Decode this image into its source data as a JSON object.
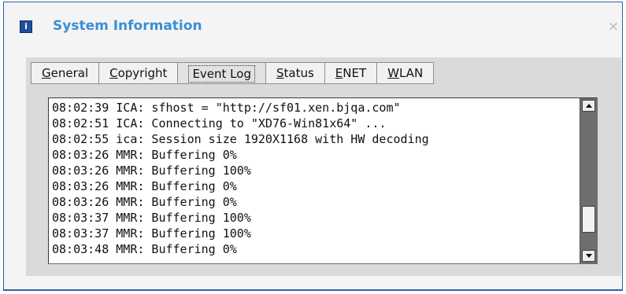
{
  "window": {
    "title": "System Information",
    "close_glyph": "×",
    "icon": "info-icon",
    "icon_glyph": "i"
  },
  "tabs": [
    {
      "label": "General",
      "mnemonic": "G",
      "active": false
    },
    {
      "label": "Copyright",
      "mnemonic": "C",
      "active": false
    },
    {
      "label": "Event Log",
      "mnemonic": "",
      "active": true
    },
    {
      "label": "Status",
      "mnemonic": "S",
      "active": false
    },
    {
      "label": "ENET",
      "mnemonic": "E",
      "active": false
    },
    {
      "label": "WLAN",
      "mnemonic": "W",
      "active": false
    }
  ],
  "event_log": {
    "lines": [
      "08:02:39 ICA: sfhost = \"http://sf01.xen.bjqa.com\"",
      "08:02:51 ICA: Connecting to \"XD76-Win81x64\" ...",
      "08:02:55 ica: Session size 1920X1168 with HW decoding",
      "08:03:26 MMR: Buffering 0%",
      "08:03:26 MMR: Buffering 100%",
      "08:03:26 MMR: Buffering 0%",
      "08:03:26 MMR: Buffering 0%",
      "08:03:37 MMR: Buffering 100%",
      "08:03:37 MMR: Buffering 100%",
      "08:03:48 MMR: Buffering 0%"
    ]
  },
  "colors": {
    "title": "#3b8fd6",
    "frame_border": "#2f5fa8",
    "panel_bg": "#dadada",
    "scroll_track": "#6e6e6e"
  }
}
